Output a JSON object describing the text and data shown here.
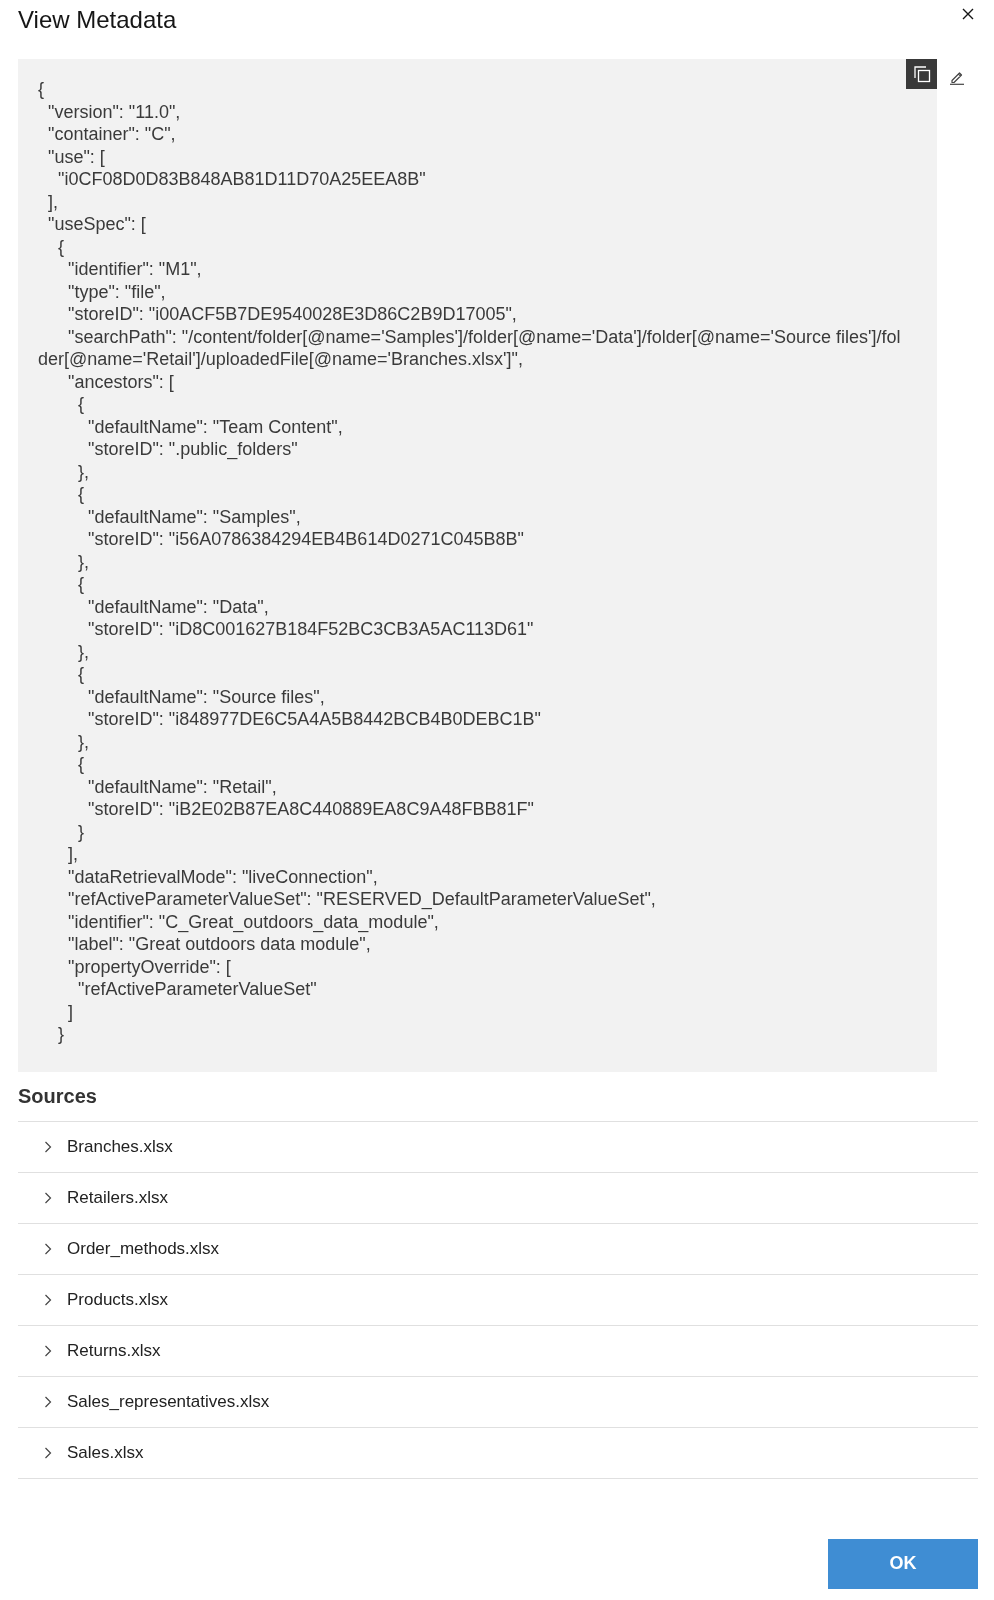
{
  "dialog": {
    "title": "View Metadata"
  },
  "metadata": {
    "lines": [
      "{",
      "  \"version\": \"11.0\",",
      "  \"container\": \"C\",",
      "  \"use\": [",
      "    \"i0CF08D0D83B848AB81D11D70A25EEA8B\"",
      "  ],",
      "  \"useSpec\": [",
      "    {",
      "      \"identifier\": \"M1\",",
      "      \"type\": \"file\",",
      "      \"storeID\": \"i00ACF5B7DE9540028E3D86C2B9D17005\",",
      "      \"searchPath\": \"/content/folder[@name='Samples']/folder[@name='Data']/folder[@name='Source files']/folder[@name='Retail']/uploadedFile[@name='Branches.xlsx']\",",
      "      \"ancestors\": [",
      "        {",
      "          \"defaultName\": \"Team Content\",",
      "          \"storeID\": \".public_folders\"",
      "        },",
      "        {",
      "          \"defaultName\": \"Samples\",",
      "          \"storeID\": \"i56A0786384294EB4B614D0271C045B8B\"",
      "        },",
      "        {",
      "          \"defaultName\": \"Data\",",
      "          \"storeID\": \"iD8C001627B184F52BC3CB3A5AC113D61\"",
      "        },",
      "        {",
      "          \"defaultName\": \"Source files\",",
      "          \"storeID\": \"i848977DE6C5A4A5B8442BCB4B0DEBC1B\"",
      "        },",
      "        {",
      "          \"defaultName\": \"Retail\",",
      "          \"storeID\": \"iB2E02B87EA8C440889EA8C9A48FBB81F\"",
      "        }",
      "      ],",
      "      \"dataRetrievalMode\": \"liveConnection\",",
      "      \"refActiveParameterValueSet\": \"RESERVED_DefaultParameterValueSet\",",
      "      \"identifier\": \"C_Great_outdoors_data_module\",",
      "      \"label\": \"Great outdoors data module\",",
      "      \"propertyOverride\": [",
      "        \"refActiveParameterValueSet\"",
      "      ]",
      "    }"
    ]
  },
  "sources": {
    "heading": "Sources",
    "items": [
      {
        "label": "Branches.xlsx",
        "expanded": false
      },
      {
        "label": "Retailers.xlsx",
        "expanded": false
      },
      {
        "label": "Order_methods.xlsx",
        "expanded": false
      },
      {
        "label": "Products.xlsx",
        "expanded": false
      },
      {
        "label": "Returns.xlsx",
        "expanded": false
      },
      {
        "label": "Sales_representatives.xlsx",
        "expanded": false
      },
      {
        "label": "Sales.xlsx",
        "expanded": false
      }
    ]
  },
  "buttons": [
    {
      "label": "OK",
      "kind": "primary"
    }
  ]
}
